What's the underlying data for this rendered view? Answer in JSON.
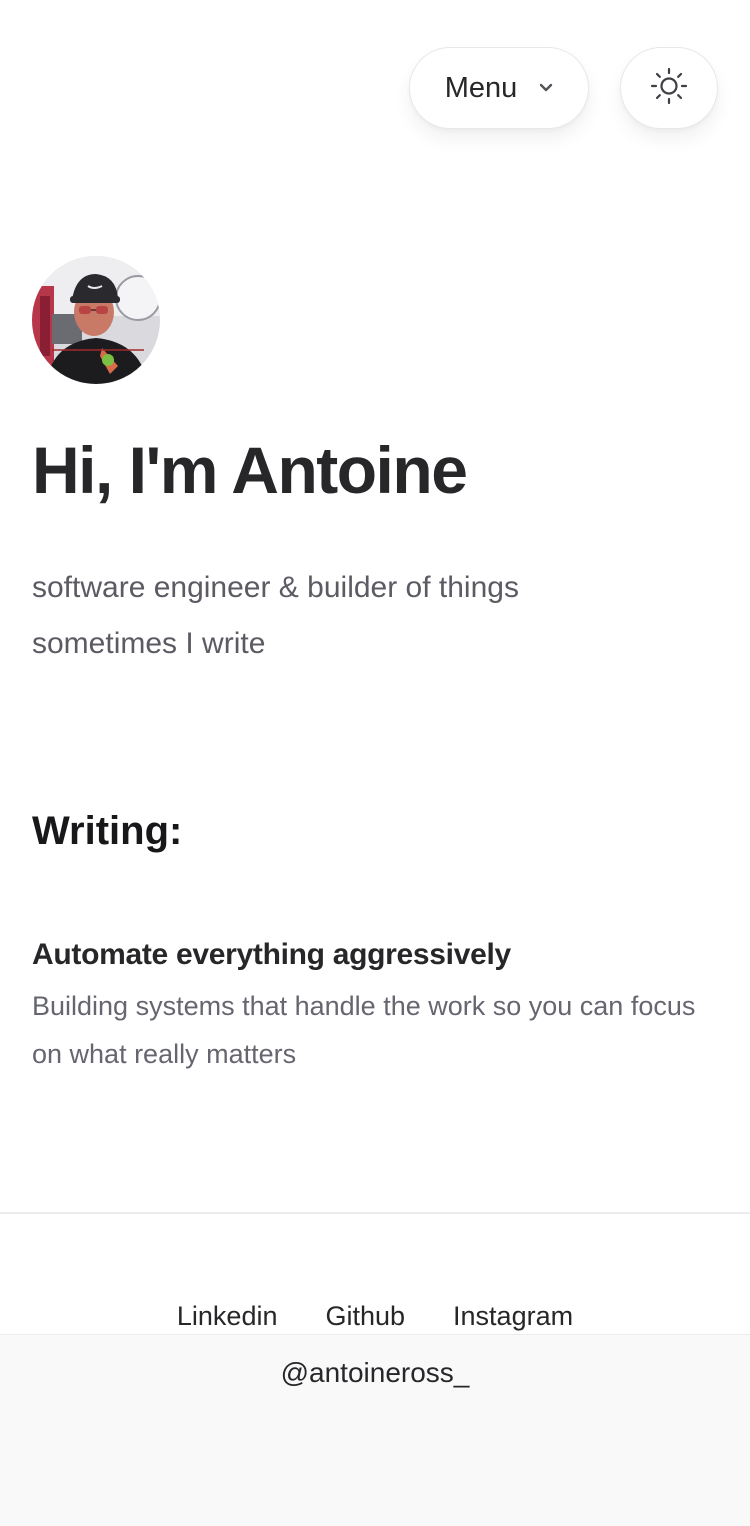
{
  "header": {
    "menu_label": "Menu",
    "menu_icon": "chevron-down-icon",
    "theme_icon": "sun-icon"
  },
  "hero": {
    "title": "Hi, I'm Antoine",
    "bio_line1": "software engineer & builder of things",
    "bio_line2": "sometimes I write"
  },
  "writing": {
    "section_title": "Writing:",
    "posts": [
      {
        "title": "Automate everything aggressively",
        "description": "Building systems that handle the work so you can focus on what really matters"
      }
    ]
  },
  "footer": {
    "links": [
      "Linkedin",
      "Github",
      "Instagram"
    ],
    "handle": "@antoineross_"
  },
  "colors": {
    "text_primary": "#27272a",
    "text_muted": "#5b5b63",
    "background": "#ffffff",
    "footer_background": "#f9f9fa"
  }
}
